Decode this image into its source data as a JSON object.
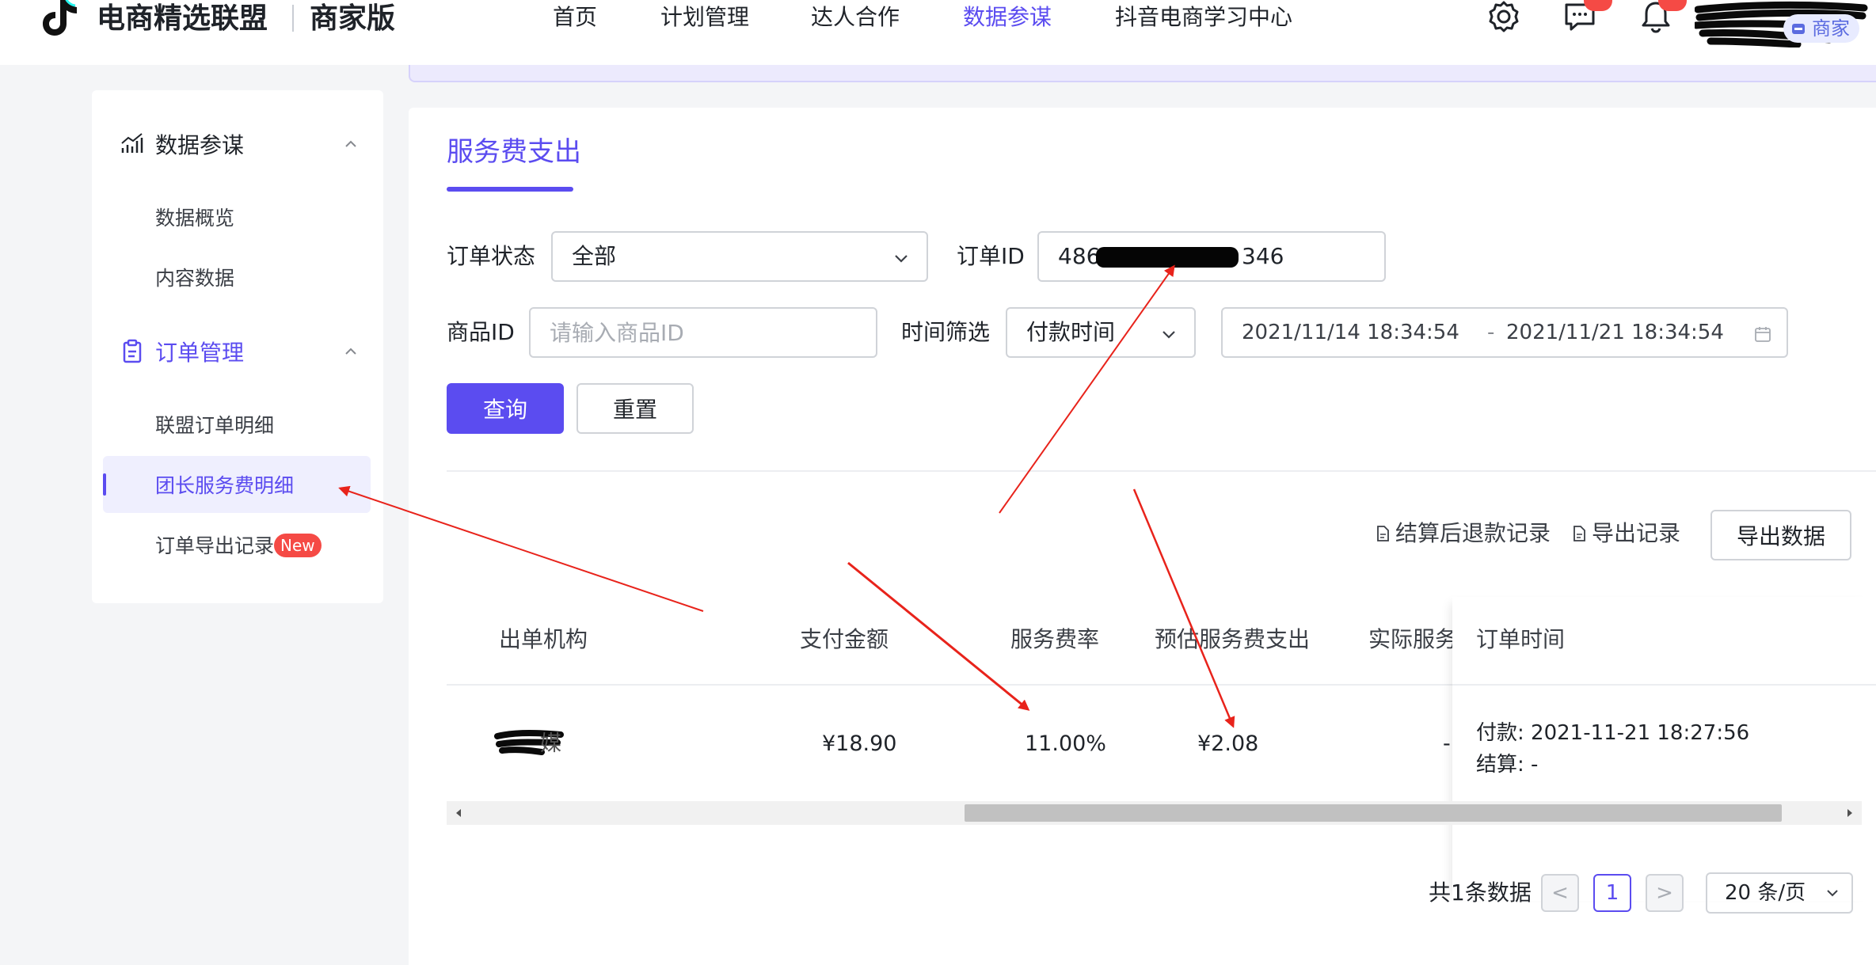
{
  "header": {
    "brand": "电商精选联盟",
    "brand_sub": "商家版",
    "nav": [
      {
        "label": "首页"
      },
      {
        "label": "计划管理"
      },
      {
        "label": "达人合作"
      },
      {
        "label": "数据参谋",
        "active": true
      },
      {
        "label": "抖音电商学习中心"
      }
    ],
    "icons": [
      "settings-icon",
      "message-icon",
      "bell-icon"
    ],
    "role_tag": "商家",
    "accent_color": "#5b4cf0"
  },
  "sidebar": {
    "groups": [
      {
        "label": "数据参谋",
        "icon": "chart-icon",
        "items": [
          {
            "label": "数据概览"
          },
          {
            "label": "内容数据"
          }
        ]
      },
      {
        "label": "订单管理",
        "icon": "clipboard-icon",
        "active": true,
        "items": [
          {
            "label": "联盟订单明细"
          },
          {
            "label": "团长服务费明细",
            "active": true
          },
          {
            "label": "订单导出记录",
            "badge": "New"
          }
        ]
      }
    ]
  },
  "main": {
    "tab": "服务费支出",
    "filters": {
      "order_status_label": "订单状态",
      "order_status_value": "全部",
      "order_id_label": "订单ID",
      "order_id_value_start": "486",
      "order_id_value_end": "346",
      "product_id_label": "商品ID",
      "product_id_placeholder": "请输入商品ID",
      "time_filter_label": "时间筛选",
      "time_filter_value": "付款时间",
      "date_start": "2021/11/14 18:34:54",
      "date_sep": "-",
      "date_end": "2021/11/21 18:34:54"
    },
    "buttons": {
      "query": "查询",
      "reset": "重置"
    },
    "actions": {
      "refund_records": "结算后退款记录",
      "export_records": "导出记录",
      "export_data": "导出数据"
    },
    "table": {
      "columns": [
        "出单机构",
        "支付金额",
        "服务费率",
        "预估服务费支出",
        "实际服务",
        "订单时间"
      ],
      "rows": [
        {
          "org_visible": "媒",
          "amount": "¥18.90",
          "rate": "11.00%",
          "estimated_fee": "¥2.08",
          "actual_fee": "-",
          "pay_time": "付款: 2021-11-21 18:27:56",
          "settle_time": "结算: -"
        }
      ]
    },
    "pagination": {
      "total": "共1条数据",
      "prev": "<",
      "current": "1",
      "next": ">",
      "page_size": "20 条/页"
    }
  }
}
